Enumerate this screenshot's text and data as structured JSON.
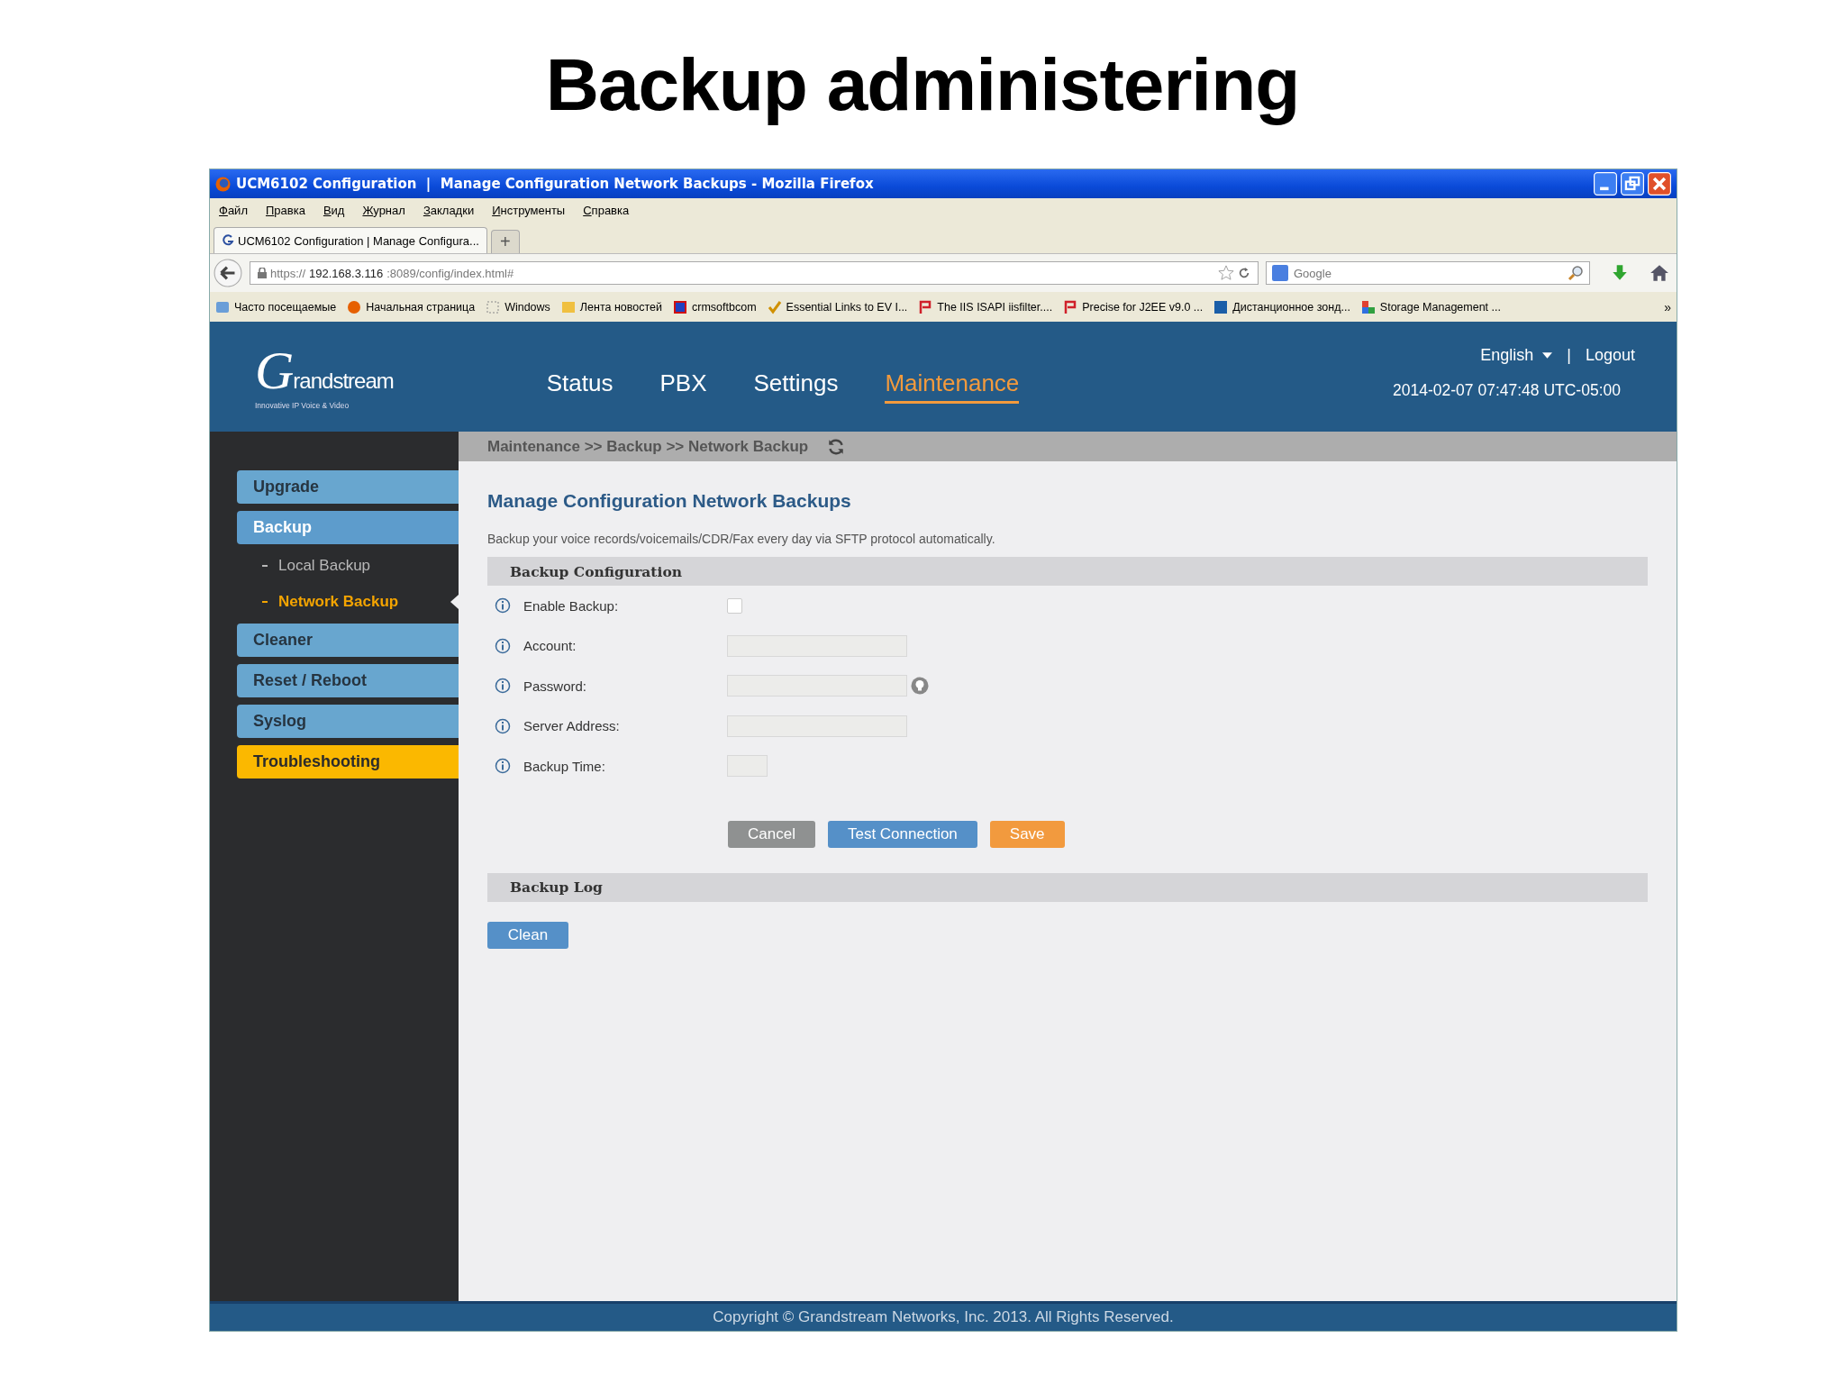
{
  "slide_title": "Backup administering",
  "window": {
    "title": "UCM6102 Configuration  |  Manage Configuration Network Backups - Mozilla Firefox"
  },
  "menu": [
    "Файл",
    "Правка",
    "Вид",
    "Журнал",
    "Закладки",
    "Инструменты",
    "Справка"
  ],
  "tabs": [
    {
      "label": "UCM6102 Configuration | Manage Configura...",
      "selected": true
    }
  ],
  "new_tab": "+",
  "address": {
    "scheme": "https://",
    "host": "192.168.3.116",
    "rest": ":8089/config/index.html#"
  },
  "search": {
    "placeholder": "Google"
  },
  "bookmarks": [
    {
      "label": "Часто посещаемые",
      "kind": "folder"
    },
    {
      "label": "Начальная страница",
      "kind": "firefox"
    },
    {
      "label": "Windows",
      "kind": "page"
    },
    {
      "label": "Лента новостей",
      "kind": "feed"
    },
    {
      "label": "crmsoftbcom",
      "kind": "cube"
    },
    {
      "label": "Essential Links to EV I...",
      "kind": "check"
    },
    {
      "label": "The IIS ISAPI iisfilter....",
      "kind": "flag"
    },
    {
      "label": "Precise for J2EE v9.0 ...",
      "kind": "flag"
    },
    {
      "label": "Дистанционное зонд...",
      "kind": "app"
    },
    {
      "label": "Storage Management ...",
      "kind": "puzzle"
    }
  ],
  "bookmarks_more": "»",
  "app": {
    "logo": {
      "name": "Grandstream",
      "tagline": "Innovative IP Voice & Video"
    },
    "nav": [
      {
        "label": "Status",
        "selected": false
      },
      {
        "label": "PBX",
        "selected": false
      },
      {
        "label": "Settings",
        "selected": false
      },
      {
        "label": "Maintenance",
        "selected": true
      }
    ],
    "language": "English",
    "separator": "|",
    "logout": "Logout",
    "datetime": "2014-02-07 07:47:48 UTC-05:00",
    "breadcrumb": "Maintenance >> Backup >> Network Backup",
    "sidebar": {
      "items": [
        {
          "label": "Upgrade",
          "kind": "normal",
          "selected": false
        },
        {
          "label": "Backup",
          "kind": "normal",
          "selected": true,
          "children": [
            {
              "label": "Local Backup",
              "selected": false
            },
            {
              "label": "Network Backup",
              "selected": true
            }
          ]
        },
        {
          "label": "Cleaner",
          "kind": "normal",
          "selected": false
        },
        {
          "label": "Reset / Reboot",
          "kind": "normal",
          "selected": false
        },
        {
          "label": "Syslog",
          "kind": "normal",
          "selected": false
        },
        {
          "label": "Troubleshooting",
          "kind": "accent",
          "selected": false
        }
      ]
    },
    "heading": "Manage Configuration Network Backups",
    "description": "Backup your voice records/voicemails/CDR/Fax every day via SFTP protocol automatically.",
    "config_section": "Backup Configuration",
    "fields": [
      {
        "label": "Enable Backup:",
        "kind": "checkbox",
        "checked": false
      },
      {
        "label": "Account:",
        "kind": "text"
      },
      {
        "label": "Password:",
        "kind": "password"
      },
      {
        "label": "Server Address:",
        "kind": "text"
      },
      {
        "label": "Backup Time:",
        "kind": "short"
      }
    ],
    "buttons": [
      {
        "label": "Cancel",
        "kind": "cancel"
      },
      {
        "label": "Test Connection",
        "kind": "primary"
      },
      {
        "label": "Save",
        "kind": "save"
      }
    ],
    "log_section": "Backup Log",
    "log_button": "Clean",
    "footer": "Copyright © Grandstream Networks, Inc. 2013. All Rights Reserved."
  }
}
